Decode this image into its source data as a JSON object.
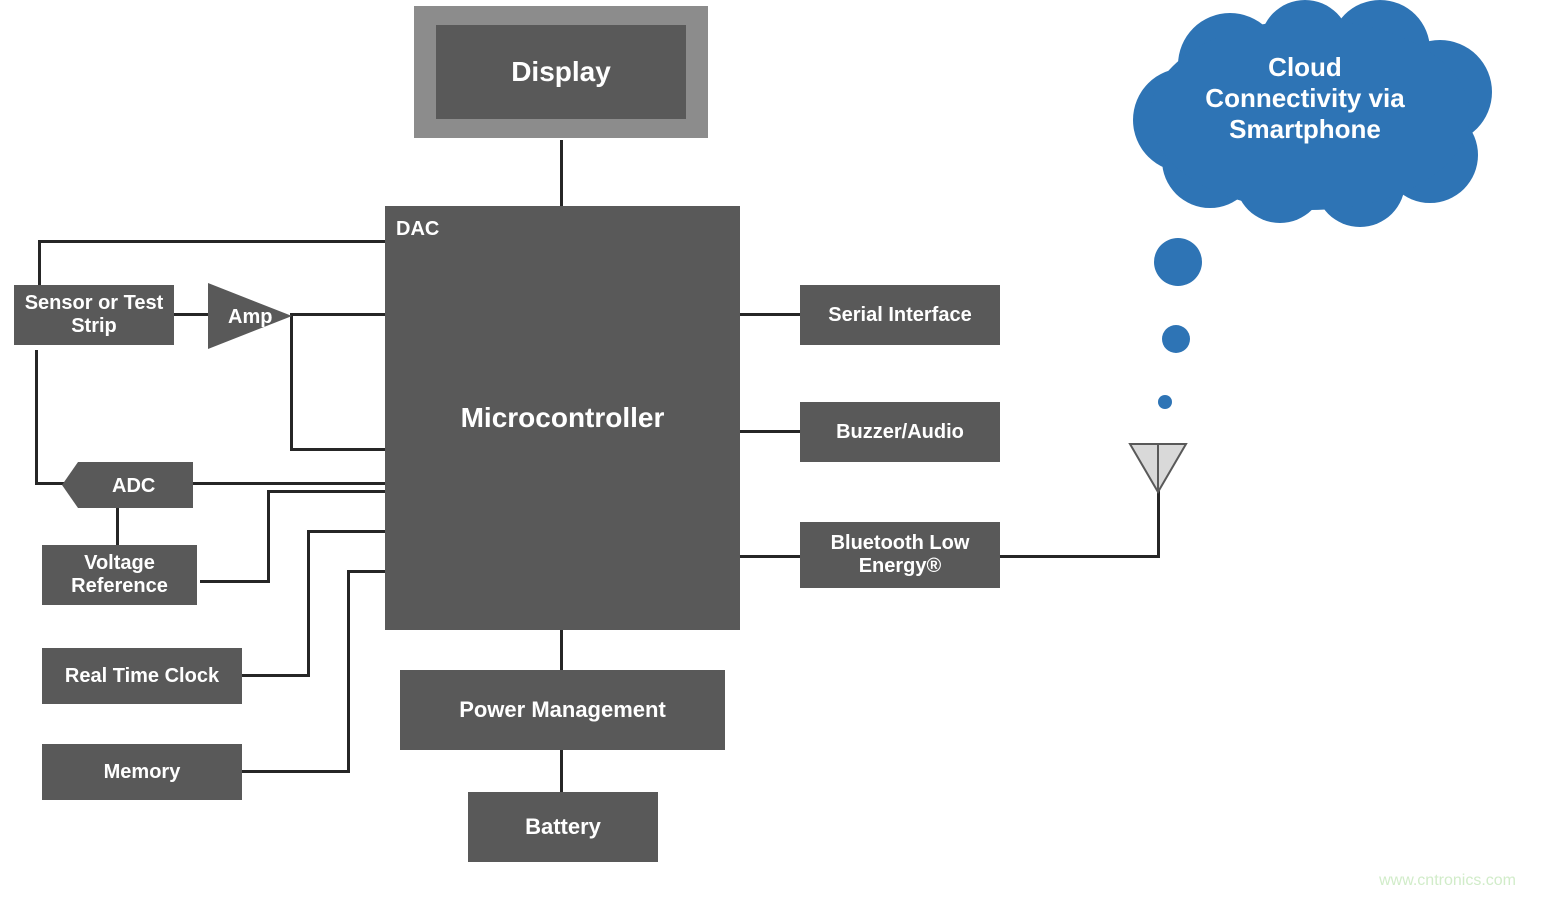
{
  "blocks": {
    "display": "Display",
    "microcontroller": "Microcontroller",
    "dac": "DAC",
    "sensor": "Sensor or Test\nStrip",
    "amp": "Amp",
    "adc": "ADC",
    "voltage_ref": "Voltage\nReference",
    "rtc": "Real Time Clock",
    "memory": "Memory",
    "power_mgmt": "Power Management",
    "battery": "Battery",
    "serial": "Serial Interface",
    "buzzer": "Buzzer/Audio",
    "ble": "Bluetooth Low\nEnergy®"
  },
  "cloud": "Cloud\nConnectivity via\nSmartphone",
  "watermark": "www.cntronics.com"
}
